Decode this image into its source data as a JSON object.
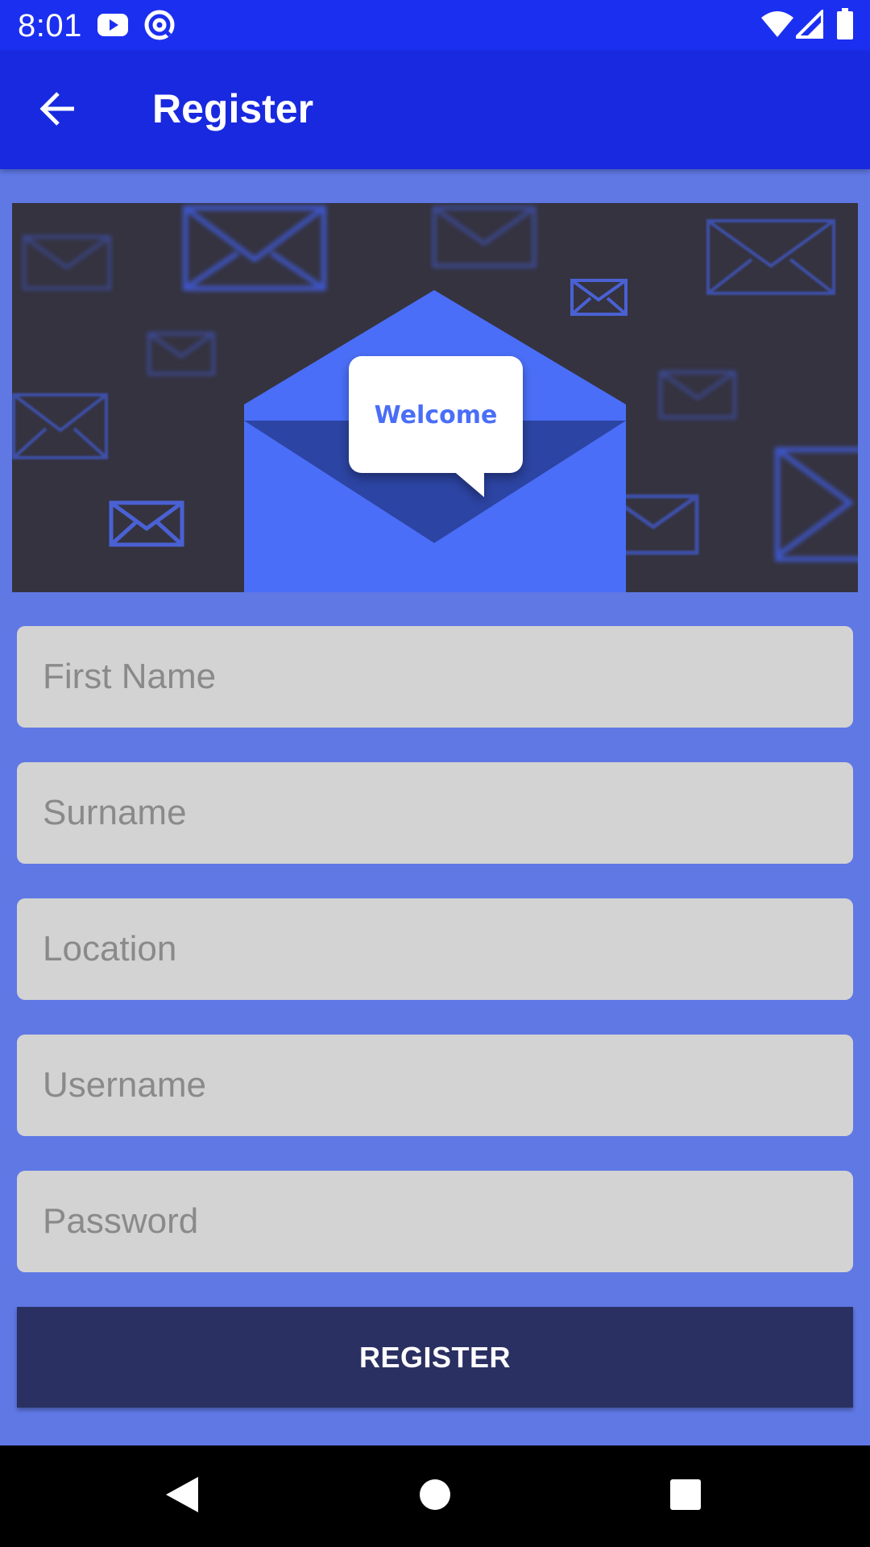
{
  "status_bar": {
    "time": "8:01",
    "icons": [
      "youtube-icon",
      "at-sign-icon",
      "wifi-icon",
      "cell-signal-icon",
      "battery-icon"
    ]
  },
  "app_bar": {
    "title": "Register",
    "back_icon": "arrow-left-icon"
  },
  "banner": {
    "welcome_text": "Welcome"
  },
  "form": {
    "fields": [
      {
        "placeholder": "First Name",
        "value": ""
      },
      {
        "placeholder": "Surname",
        "value": ""
      },
      {
        "placeholder": "Location",
        "value": ""
      },
      {
        "placeholder": "Username",
        "value": ""
      },
      {
        "placeholder": "Password",
        "value": ""
      }
    ],
    "submit_label": "REGISTER"
  },
  "nav_bar": {
    "icons": [
      "back-triangle-icon",
      "home-circle-icon",
      "recents-square-icon"
    ]
  },
  "colors": {
    "status_bar": "#1b2ff0",
    "app_bar": "#1929df",
    "background": "#5f78e4",
    "field": "#d3d3d3",
    "button": "#2a3061",
    "banner_bg": "#35333f",
    "envelope": "#4a6ef7",
    "welcome_text": "#4a6ef7"
  }
}
